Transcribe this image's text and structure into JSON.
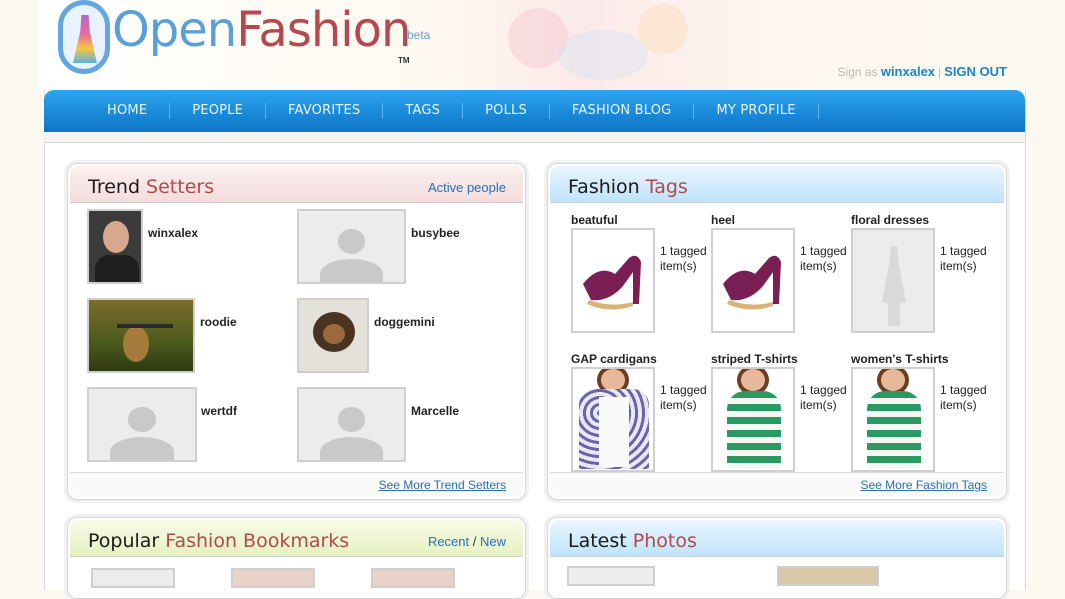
{
  "logo": {
    "part1": "Open",
    "part2": "Fashion",
    "beta": "beta",
    "tm": "TM"
  },
  "signin": {
    "prefix": "Sign as",
    "username": "winxalex",
    "separator": "|",
    "signout": "SIGN OUT"
  },
  "nav": [
    "HOME",
    "PEOPLE",
    "FAVORITES",
    "TAGS",
    "POLLS",
    "FASHION BLOG",
    "MY PROFILE"
  ],
  "trend": {
    "title_a": "Trend ",
    "title_b": "Setters",
    "link": "Active people",
    "people": [
      "winxalex",
      "busybee",
      "roodie",
      "doggemini",
      "wertdf",
      "Marcelle"
    ],
    "footer": "See More Trend Setters"
  },
  "tags": {
    "title_a": "Fashion ",
    "title_b": "Tags",
    "items": [
      {
        "name": "beatuful",
        "count": "1 tagged item(s)"
      },
      {
        "name": "heel",
        "count": "1 tagged item(s)"
      },
      {
        "name": "floral dresses",
        "count": "1 tagged item(s)"
      },
      {
        "name": "GAP cardigans",
        "count": "1 tagged item(s)"
      },
      {
        "name": "striped T-shirts",
        "count": "1 tagged item(s)"
      },
      {
        "name": "women's T-shirts",
        "count": "1 tagged item(s)"
      }
    ],
    "footer": "See More Fashion Tags"
  },
  "bookmarks": {
    "title_a": "Popular ",
    "title_b": "Fashion Bookmarks",
    "link_a": "Recent",
    "link_sep": " / ",
    "link_b": "New"
  },
  "photos": {
    "title_a": "Latest ",
    "title_b": "Photos"
  },
  "colors": {
    "nav_blue": "#1a8ad9",
    "accent_red": "#b24a4a",
    "link_blue": "#2a6eb7"
  }
}
